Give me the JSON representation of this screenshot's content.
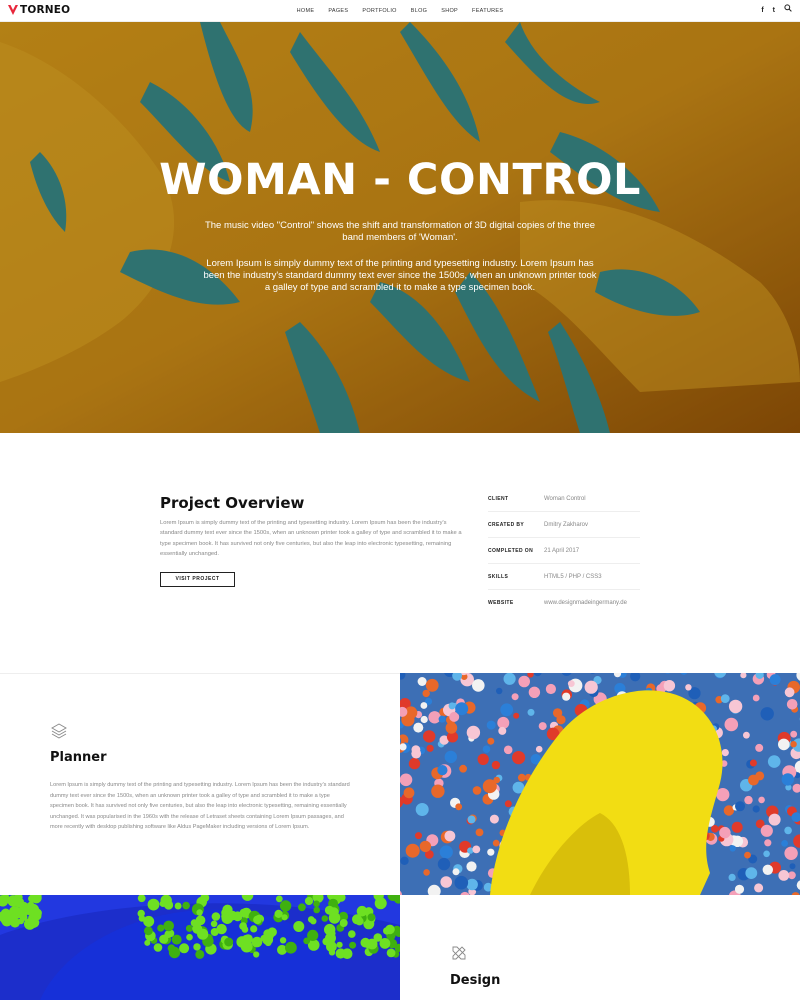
{
  "header": {
    "logo_text": "TORNEO",
    "nav": [
      "HOME",
      "PAGES",
      "PORTFOLIO",
      "BLOG",
      "SHOP",
      "FEATURES"
    ],
    "social_icons": [
      "facebook-icon",
      "twitter-icon",
      "search-icon"
    ],
    "social_glyphs": [
      "f",
      "t",
      "⌕"
    ]
  },
  "hero": {
    "title": "WOMAN - CONTROL",
    "text_1": "The music video \"Control\" shows the shift and transformation of 3D digital copies of the three band members of 'Woman'.",
    "text_2": "Lorem Ipsum is simply dummy text of the printing and typesetting industry. Lorem Ipsum has been the industry's standard dummy text ever since the 1500s, when an unknown printer took a galley of type and scrambled it to make a type specimen book.",
    "colors": {
      "background": "#b47a12",
      "leaf": "#1f8f9c"
    }
  },
  "overview": {
    "title": "Project Overview",
    "body": "Lorem Ipsum is simply dummy text of the printing and typesetting industry. Lorem Ipsum has been the industry's standard dummy text ever since the 1500s, when an unknown printer took a galley of type and scrambled it to make a type specimen book. It has survived not only five centuries, but also the leap into electronic typesetting, remaining essentially unchanged.",
    "button_label": "VISIT PROJECT",
    "details": [
      {
        "label": "CLIENT",
        "value": "Woman Control"
      },
      {
        "label": "CREATED BY",
        "value": "Dmitry Zakharov"
      },
      {
        "label": "COMPLETED ON",
        "value": "21 April 2017"
      },
      {
        "label": "SKILLS",
        "value": "HTML5 / PHP / CSS3"
      },
      {
        "label": "WEBSITE",
        "value": "www.designmadeingermany.de"
      }
    ]
  },
  "planner": {
    "icon": "layers-icon",
    "title": "Planner",
    "body": "Lorem Ipsum is simply dummy text of the printing and typesetting industry. Lorem Ipsum has been the industry's standard dummy text ever since the 1500s, when an unknown printer took a galley of type and scrambled it to make a type specimen book. It has survived not only five centuries, but also the leap into electronic typesetting, remaining essentially unchanged. It was popularised in the 1960s with the release of Letraset sheets containing Lorem Ipsum passages, and more recently with desktop publishing software like Aldus PageMaker including versions of Lorem Ipsum."
  },
  "design": {
    "icon": "pencil-ruler-icon",
    "title": "Design"
  }
}
